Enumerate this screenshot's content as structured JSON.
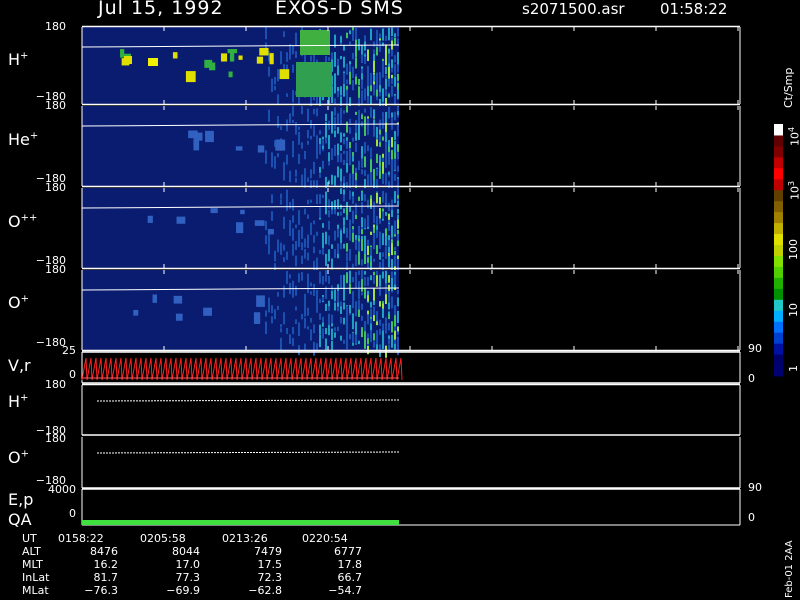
{
  "header": {
    "date": "Jul 15, 1992",
    "mission": "EXOS-D SMS",
    "file": "s2071500.asr",
    "time": "01:58:22"
  },
  "colorbar": {
    "unit": "Ct/Smp",
    "ticks": [
      "1",
      "10",
      "100",
      "10",
      "10"
    ],
    "tick_exp": [
      "",
      "",
      "",
      "3",
      "4"
    ],
    "colors": [
      "#000070",
      "#00006a",
      "#0010a0",
      "#0040d0",
      "#0070ff",
      "#00b0ff",
      "#20c8c8",
      "#009000",
      "#20b000",
      "#50d000",
      "#80e000",
      "#c0d000",
      "#e0e000",
      "#c0b000",
      "#a08000",
      "#806000",
      "#604000",
      "#c00000",
      "#ff0000",
      "#c00000",
      "#800000",
      "#600000",
      "#ffffff"
    ]
  },
  "panels": [
    {
      "id": "h-plus",
      "species": "H",
      "charge": "+",
      "top_tick": "180",
      "bottom_tick": "−180"
    },
    {
      "id": "he-plus",
      "species": "He",
      "charge": "+",
      "top_tick": "180",
      "bottom_tick": "−180"
    },
    {
      "id": "o-plusplus",
      "species": "O",
      "charge": "++",
      "top_tick": "180",
      "bottom_tick": "−180"
    },
    {
      "id": "o-plus",
      "species": "O",
      "charge": "+",
      "top_tick": "180",
      "bottom_tick": "−180"
    }
  ],
  "vr_panel": {
    "label": "V,r",
    "top_tick": "25",
    "bottom_tick": "0",
    "right_top": "90",
    "right_bottom": "0"
  },
  "lower_panels": [
    {
      "id": "h-plus-lower",
      "species": "H",
      "charge": "+",
      "top_tick": "180",
      "bottom_tick": "−180"
    },
    {
      "id": "o-plus-lower",
      "species": "O",
      "charge": "+",
      "top_tick": "180",
      "bottom_tick": "−180"
    }
  ],
  "ep_panel": {
    "label": "E,p",
    "label2": "QA",
    "top_tick": "4000",
    "bottom_tick": "0",
    "right_top": "90",
    "right_bottom": "0"
  },
  "ephemeris": {
    "labels": [
      "UT",
      "ALT",
      "MLT",
      "InLat",
      "MLat"
    ],
    "columns": [
      [
        "0158:22",
        "8476",
        "16.2",
        "81.7",
        "−76.3"
      ],
      [
        "0205:58",
        "8044",
        "17.0",
        "77.3",
        "−69.9"
      ],
      [
        "0213:26",
        "7479",
        "17.5",
        "72.3",
        "−62.8"
      ],
      [
        "0220:54",
        "6777",
        "17.8",
        "66.7",
        "−54.7"
      ]
    ]
  },
  "footer_text": "Feb-01 2AA"
}
